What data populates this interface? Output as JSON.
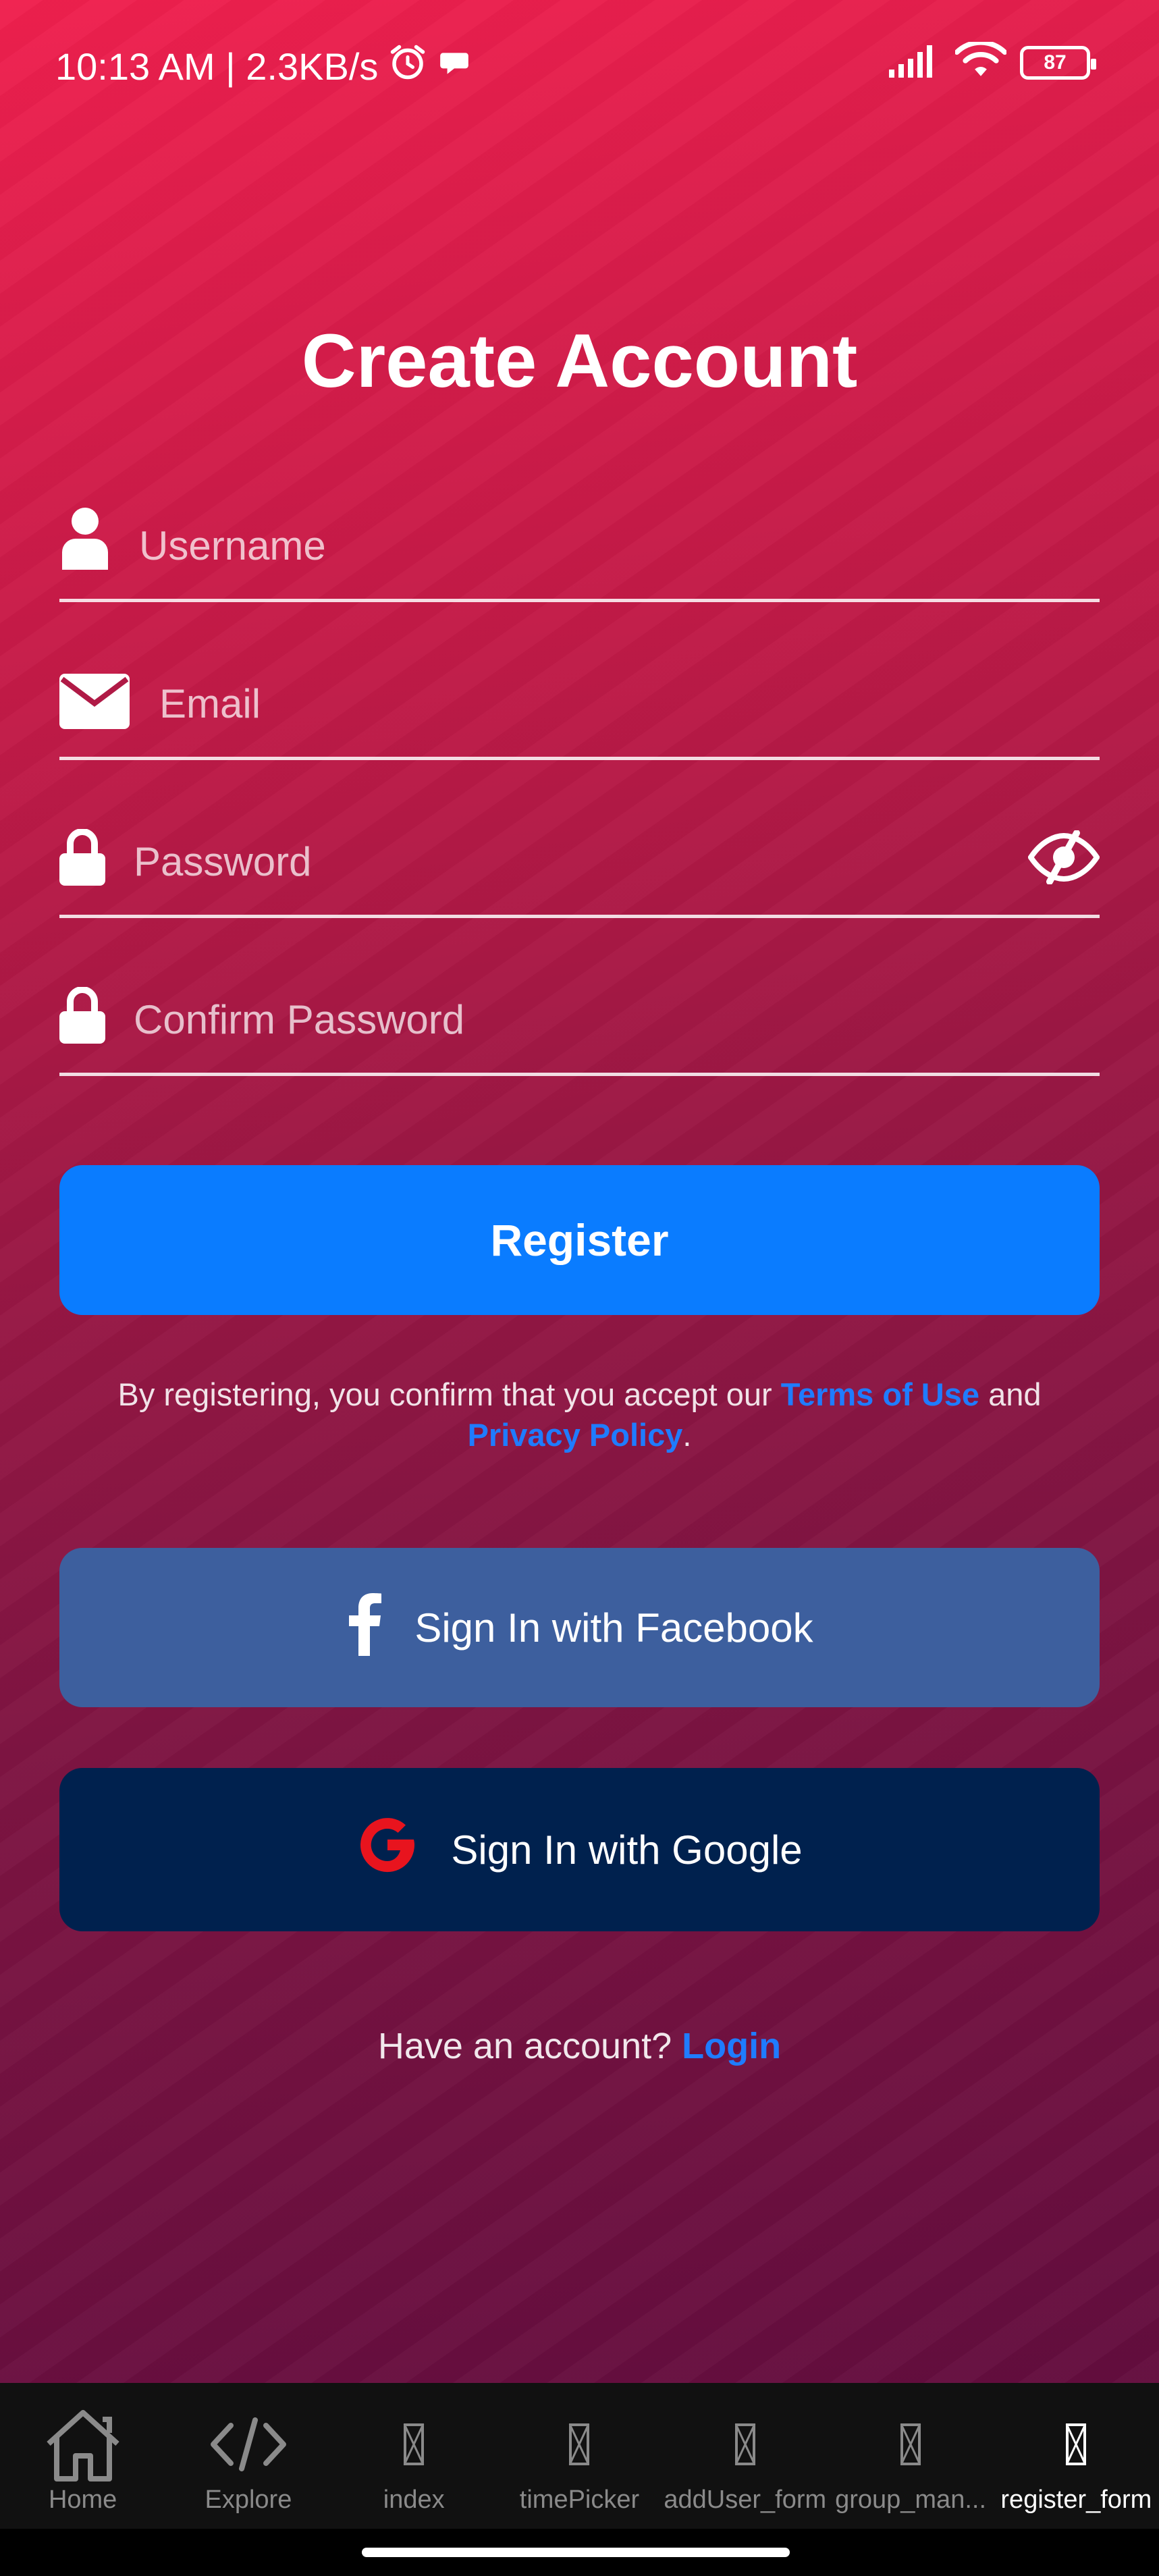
{
  "status_bar": {
    "time_speed": "10:13 AM | 2.3KB/s",
    "battery": "87"
  },
  "page": {
    "title": "Create Account"
  },
  "form": {
    "username_placeholder": "Username",
    "email_placeholder": "Email",
    "password_placeholder": "Password",
    "confirm_password_placeholder": "Confirm Password"
  },
  "register_button": "Register",
  "terms": {
    "prefix": "By registering, you confirm that you accept our ",
    "terms_link": "Terms of Use",
    "and": " and ",
    "privacy_link": "Privacy Policy",
    "suffix": "."
  },
  "social": {
    "facebook": "Sign In with Facebook",
    "google": "Sign In with Google"
  },
  "login_prompt": {
    "text": "Have an account? ",
    "link": "Login"
  },
  "bottom_nav": {
    "items": [
      {
        "label": "Home",
        "icon": "home-icon"
      },
      {
        "label": "Explore",
        "icon": "code-icon"
      },
      {
        "label": "index",
        "icon": "placeholder-icon"
      },
      {
        "label": "timePicker",
        "icon": "placeholder-icon"
      },
      {
        "label": "addUser_form",
        "icon": "placeholder-icon"
      },
      {
        "label": "group_man...",
        "icon": "placeholder-icon"
      },
      {
        "label": "register_form",
        "icon": "placeholder-icon"
      }
    ],
    "active_index": 6
  },
  "colors": {
    "register_button": "#0a7cff",
    "facebook_button": "#3d5f9e",
    "google_button": "#00214e",
    "link": "#1f7cff"
  }
}
